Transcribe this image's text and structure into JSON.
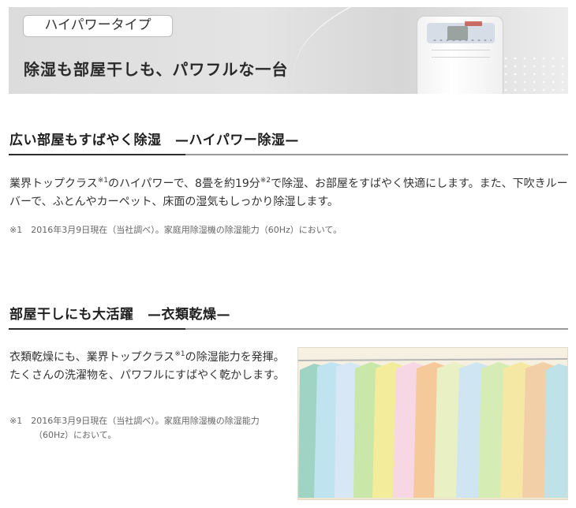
{
  "banner": {
    "tag": "ハイパワータイプ",
    "headline": "除湿も部屋干しも、パワフルな一台"
  },
  "section1": {
    "title": "広い部屋もすばやく除湿　—ハイパワー除湿—",
    "text_a": "業界トップクラス",
    "mark_1": "※1",
    "text_b": "のハイパワーで、8畳を約19分",
    "mark_2": "※2",
    "text_c": "で除湿、お部屋をすばやく快適にします。また、下吹きルーバーで、ふとんやカーペット、床面の湿気もしっかり除湿します。",
    "note": "※1　2016年3月9日現在（当社調べ）。家庭用除湿機の除湿能力（60Hz）において。"
  },
  "section2": {
    "title": "部屋干しにも大活躍　—衣類乾燥—",
    "text_a": "衣類乾燥にも、業界トップクラス",
    "mark_1": "※1",
    "text_b": "の除湿能力を発揮。たくさんの洗濯物を、パワフルにすばやく乾かします。",
    "note_line1": "※1　2016年3月9日現在（当社調べ）。家庭用除湿機の除湿能力",
    "note_line2": "（60Hz）において。"
  },
  "colors": {
    "rule_dark": "#2b2b2b",
    "rule_light": "#9a9a9a"
  }
}
